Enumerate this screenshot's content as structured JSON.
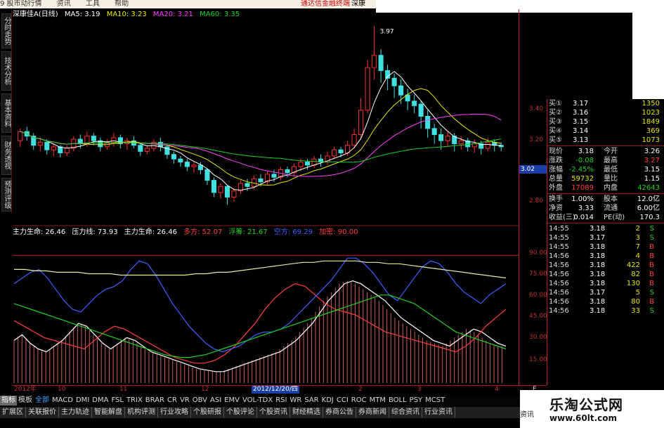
{
  "menubar": {
    "items": [
      "9 股市动行情",
      "资讯",
      "工具",
      "帮助"
    ],
    "promo": "通达信金融终端",
    "promo2": "深康"
  },
  "stock": {
    "title": "深康佳A(日线)"
  },
  "ma": [
    {
      "label": "MA5: 3.19",
      "color": "#ffffff"
    },
    {
      "label": "MA10: 3.23",
      "color": "#e8e800"
    },
    {
      "label": "MA20: 3.21",
      "color": "#ff40ff"
    },
    {
      "label": "MA60: 3.35",
      "color": "#20d020"
    }
  ],
  "peak_label": "3.97",
  "sidetabs": [
    "分时走势",
    "技术分析",
    "基本资料",
    "财务透视",
    "预测评级"
  ],
  "indicator": [
    {
      "label": "主力生命: 26.46",
      "color": "#ffffff"
    },
    {
      "label": "压力线: 73.93",
      "color": "#ffffff"
    },
    {
      "label": "主力生命: 26.46",
      "color": "#ffffff"
    },
    {
      "label": "多方: 52.07",
      "color": "#ff4040"
    },
    {
      "label": "浮筹: 21.67",
      "color": "#20d020"
    },
    {
      "label": "空方: 69.29",
      "color": "#4060ff"
    },
    {
      "label": "加密: 90.00",
      "color": "#ff4040"
    }
  ],
  "yaxis_price": [
    "3.40",
    "3.20",
    "3.02",
    "2.80"
  ],
  "yaxis_ind": [
    "90.00",
    "75.00",
    "60.00",
    "45.00",
    "30.00",
    "15.00"
  ],
  "current_tag": "3.02",
  "quote": {
    "buy": [
      {
        "label": "买①",
        "price": "3.17",
        "vol": "1350"
      },
      {
        "label": "买②",
        "price": "3.16",
        "vol": "1023"
      },
      {
        "label": "买③",
        "price": "3.15",
        "vol": "1849"
      },
      {
        "label": "买④",
        "price": "3.14",
        "vol": "369"
      },
      {
        "label": "买⑤",
        "price": "3.13",
        "vol": "1073"
      }
    ],
    "stats": [
      {
        "l1": "现价",
        "v1": "3.18",
        "l2": "今开",
        "v2": "3.26",
        "c1": "#ffffff",
        "c2": "#ffffff"
      },
      {
        "l1": "涨跌",
        "v1": "-0.08",
        "l2": "最高",
        "v2": "3.27",
        "c1": "#20d020",
        "c2": "#ff4040"
      },
      {
        "l1": "涨幅",
        "v1": "-2.45%",
        "l2": "最低",
        "v2": "3.15",
        "c1": "#20d020",
        "c2": "#ffffff"
      },
      {
        "l1": "总量",
        "v1": "59732",
        "l2": "量比",
        "v2": "1.15",
        "c1": "#e8e800",
        "c2": "#ffffff"
      },
      {
        "l1": "外盘",
        "v1": "17089",
        "l2": "内盘",
        "v2": "42643",
        "c1": "#ff4040",
        "c2": "#20d020"
      }
    ],
    "fin": [
      {
        "l1": "换手",
        "v1": "1.00%",
        "l2": "股本",
        "v2": "12.0亿"
      },
      {
        "l1": "净资",
        "v1": "3.33",
        "l2": "流通",
        "v2": "6.00亿"
      },
      {
        "l1": "收益(三)",
        "v1": "0.014",
        "l2": "PE(动)",
        "v2": "170.3"
      }
    ],
    "ticks": [
      {
        "time": "14:55",
        "price": "3.18",
        "vol": "2",
        "side": "S"
      },
      {
        "time": "14:55",
        "price": "3.17",
        "vol": "3",
        "side": "S"
      },
      {
        "time": "14:55",
        "price": "3.18",
        "vol": "7",
        "side": "B"
      },
      {
        "time": "14:56",
        "price": "3.18",
        "vol": "4",
        "side": "B"
      },
      {
        "time": "14:56",
        "price": "3.18",
        "vol": "422",
        "side": "B"
      },
      {
        "time": "14:56",
        "price": "3.18",
        "vol": "82",
        "side": "B"
      },
      {
        "time": "14:56",
        "price": "3.18",
        "vol": "130",
        "side": "B"
      },
      {
        "time": "14:56",
        "price": "3.17",
        "vol": "5",
        "side": "S"
      },
      {
        "time": "14:56",
        "price": "3.18",
        "vol": "80",
        "side": "B"
      },
      {
        "time": "14:56",
        "price": "3.18",
        "vol": "33",
        "side": "S"
      }
    ]
  },
  "xaxis": {
    "labels": [
      "2012年",
      "10",
      "11",
      "12",
      "2012/12/20/四",
      "2",
      "3",
      "4"
    ],
    "scroll_e": "E"
  },
  "tabs": [
    "指标",
    "模板",
    "全部",
    "MACD",
    "DMI",
    "DMA",
    "FSL",
    "TRIX",
    "BRAR",
    "CR",
    "VR",
    "OBV",
    "ASI",
    "EMV",
    "VOL-TDX",
    "RSI",
    "WR",
    "SAR",
    "KDJ",
    "CCI",
    "ROC",
    "MTM",
    "BOLL",
    "PSY",
    "MCST"
  ],
  "bottom": [
    "扩展区",
    "关联报价",
    "主力轨迹",
    "智能解盘",
    "机构评测",
    "行业攻略",
    "个股研报",
    "个股评论",
    "个股资讯",
    "财经精选",
    "券商公告",
    "券商新闻",
    "综合资讯",
    "行业资讯"
  ],
  "brand": {
    "name": "乐淘公式网",
    "url": "www.60lt.com",
    "side": "资讯"
  },
  "chart_data": {
    "type": "line",
    "title": "深康佳A(日线)",
    "price_ylim": [
      2.7,
      4.0
    ],
    "peak": 3.97,
    "candles": [
      [
        3.22,
        3.28,
        3.18,
        3.3
      ],
      [
        3.28,
        3.25,
        3.22,
        3.31
      ],
      [
        3.25,
        3.19,
        3.16,
        3.27
      ],
      [
        3.19,
        3.21,
        3.15,
        3.24
      ],
      [
        3.21,
        3.16,
        3.13,
        3.23
      ],
      [
        3.16,
        3.18,
        3.12,
        3.2
      ],
      [
        3.18,
        3.14,
        3.11,
        3.19
      ],
      [
        3.14,
        3.17,
        3.12,
        3.19
      ],
      [
        3.17,
        3.23,
        3.15,
        3.25
      ],
      [
        3.23,
        3.2,
        3.17,
        3.26
      ],
      [
        3.2,
        3.25,
        3.18,
        3.28
      ],
      [
        3.25,
        3.22,
        3.19,
        3.27
      ],
      [
        3.22,
        3.18,
        3.15,
        3.24
      ],
      [
        3.18,
        3.21,
        3.16,
        3.23
      ],
      [
        3.21,
        3.24,
        3.18,
        3.27
      ],
      [
        3.24,
        3.2,
        3.17,
        3.26
      ],
      [
        3.2,
        3.22,
        3.16,
        3.24
      ],
      [
        3.22,
        3.19,
        3.17,
        3.25
      ],
      [
        3.19,
        3.15,
        3.12,
        3.2
      ],
      [
        3.15,
        3.17,
        3.13,
        3.19
      ],
      [
        3.17,
        3.21,
        3.15,
        3.23
      ],
      [
        3.21,
        3.18,
        3.15,
        3.24
      ],
      [
        3.18,
        3.13,
        3.1,
        3.19
      ],
      [
        3.13,
        3.1,
        3.07,
        3.15
      ],
      [
        3.1,
        3.08,
        3.05,
        3.12
      ],
      [
        3.08,
        3.05,
        3.02,
        3.1
      ],
      [
        3.05,
        3.06,
        3.01,
        3.08
      ],
      [
        3.06,
        3.03,
        3.0,
        3.08
      ],
      [
        3.03,
        2.96,
        2.93,
        3.04
      ],
      [
        2.96,
        2.88,
        2.85,
        2.98
      ],
      [
        2.88,
        2.92,
        2.84,
        2.94
      ],
      [
        2.92,
        2.85,
        2.8,
        2.93
      ],
      [
        2.85,
        2.89,
        2.82,
        2.91
      ],
      [
        2.89,
        2.94,
        2.87,
        2.96
      ],
      [
        2.94,
        2.92,
        2.89,
        2.97
      ],
      [
        2.92,
        2.97,
        2.9,
        2.99
      ],
      [
        2.97,
        2.95,
        2.92,
        3.0
      ],
      [
        2.95,
        3.0,
        2.93,
        3.02
      ],
      [
        3.0,
        2.98,
        2.95,
        3.03
      ],
      [
        2.98,
        3.03,
        2.96,
        3.05
      ],
      [
        3.03,
        3.01,
        2.98,
        3.05
      ],
      [
        3.01,
        3.05,
        2.99,
        3.07
      ],
      [
        3.05,
        3.08,
        3.02,
        3.1
      ],
      [
        3.08,
        3.06,
        3.03,
        3.1
      ],
      [
        3.06,
        3.1,
        3.04,
        3.12
      ],
      [
        3.1,
        3.08,
        3.05,
        3.13
      ],
      [
        3.08,
        3.12,
        3.06,
        3.15
      ],
      [
        3.12,
        3.16,
        3.1,
        3.18
      ],
      [
        3.16,
        3.14,
        3.11,
        3.18
      ],
      [
        3.14,
        3.19,
        3.12,
        3.22
      ],
      [
        3.19,
        3.26,
        3.17,
        3.3
      ],
      [
        3.26,
        3.42,
        3.24,
        3.5
      ],
      [
        3.42,
        3.7,
        3.4,
        3.75
      ],
      [
        3.7,
        3.78,
        3.62,
        3.97
      ],
      [
        3.78,
        3.68,
        3.6,
        3.82
      ],
      [
        3.68,
        3.63,
        3.55,
        3.72
      ],
      [
        3.63,
        3.58,
        3.5,
        3.66
      ],
      [
        3.58,
        3.52,
        3.46,
        3.62
      ],
      [
        3.52,
        3.48,
        3.42,
        3.56
      ],
      [
        3.48,
        3.45,
        3.4,
        3.52
      ],
      [
        3.46,
        3.38,
        3.3,
        3.48
      ],
      [
        3.38,
        3.3,
        3.24,
        3.42
      ],
      [
        3.3,
        3.26,
        3.2,
        3.33
      ],
      [
        3.26,
        3.22,
        3.16,
        3.3
      ],
      [
        3.22,
        3.25,
        3.18,
        3.28
      ],
      [
        3.25,
        3.2,
        3.15,
        3.27
      ],
      [
        3.2,
        3.22,
        3.16,
        3.25
      ],
      [
        3.22,
        3.18,
        3.15,
        3.24
      ],
      [
        3.18,
        3.2,
        3.14,
        3.23
      ],
      [
        3.2,
        3.17,
        3.13,
        3.22
      ],
      [
        3.17,
        3.21,
        3.15,
        3.24
      ],
      [
        3.21,
        3.19,
        3.15,
        3.23
      ],
      [
        3.19,
        3.18,
        3.15,
        3.21
      ]
    ],
    "series": [
      {
        "name": "主力生命",
        "color": "#ffffff",
        "values": [
          30,
          34,
          28,
          24,
          22,
          26,
          30,
          36,
          42,
          40,
          34,
          28,
          24,
          28,
          32,
          30,
          26,
          22,
          20,
          18,
          16,
          14,
          12,
          10,
          9,
          8,
          8,
          10,
          12,
          14,
          16,
          18,
          20,
          22,
          26,
          30,
          36,
          42,
          50,
          58,
          64,
          70,
          72,
          70,
          66,
          62,
          58,
          52,
          46,
          42,
          38,
          34,
          30,
          28,
          26,
          30,
          34,
          38,
          36,
          32,
          28,
          26
        ]
      },
      {
        "name": "多方",
        "color": "#ff4040",
        "values": [
          44,
          40,
          36,
          32,
          30,
          28,
          26,
          24,
          30,
          36,
          40,
          38,
          34,
          30,
          26,
          22,
          18,
          16,
          14,
          14,
          16,
          20,
          26,
          34,
          42,
          52,
          60,
          66,
          70,
          68,
          62,
          56,
          52,
          50,
          48,
          44,
          40,
          36,
          34,
          32,
          30,
          28,
          26,
          24,
          22,
          26,
          32,
          40,
          46,
          52
        ]
      },
      {
        "name": "空方",
        "color": "#4060ff",
        "values": [
          70,
          74,
          78,
          80,
          74,
          66,
          58,
          52,
          50,
          56,
          62,
          66,
          68,
          72,
          80,
          86,
          84,
          76,
          66,
          56,
          48,
          40,
          34,
          28,
          24,
          22,
          24,
          26,
          30,
          34,
          36,
          36,
          38,
          42,
          48,
          54,
          60,
          66,
          72,
          80,
          88,
          88,
          84,
          78,
          70,
          62,
          58,
          66,
          74,
          82,
          86,
          84,
          78,
          70,
          64,
          60,
          56,
          62,
          66,
          70
        ]
      },
      {
        "name": "浮筹",
        "color": "#20d020",
        "values": [
          56,
          54,
          52,
          50,
          48,
          46,
          44,
          42,
          40,
          38,
          36,
          34,
          32,
          30,
          28,
          26,
          24,
          22,
          20,
          19,
          18,
          18,
          19,
          20,
          22,
          24,
          26,
          28,
          30,
          32,
          34,
          36,
          38,
          40,
          42,
          44,
          46,
          48,
          50,
          52,
          54,
          56,
          58,
          60,
          62,
          62,
          60,
          58,
          56,
          52,
          48,
          44,
          40,
          36,
          34,
          32,
          30,
          28,
          26,
          24
        ]
      },
      {
        "name": "压力线",
        "color": "#e8e8a0",
        "values": [
          80,
          80,
          79,
          79,
          78,
          78,
          78,
          77,
          77,
          77,
          76,
          76,
          76,
          76,
          76,
          76,
          76,
          77,
          77,
          78,
          78,
          79,
          80,
          81,
          82,
          83,
          84,
          85,
          85,
          86,
          86,
          86,
          86,
          85,
          85,
          84,
          84,
          83,
          82,
          81,
          80,
          79,
          78,
          77,
          76,
          75,
          74
        ]
      }
    ],
    "indicator_ylim": [
      0,
      100
    ],
    "levels": [
      90
    ]
  }
}
